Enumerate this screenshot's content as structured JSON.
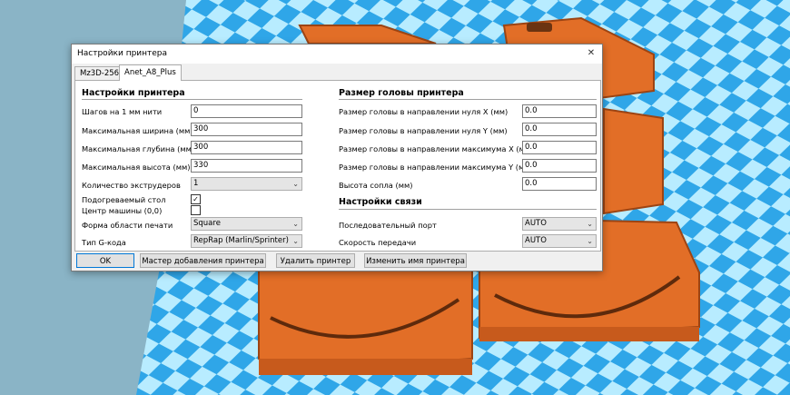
{
  "window": {
    "title": "Настройки принтера",
    "close_glyph": "✕"
  },
  "tabs": [
    {
      "label": "Mz3D-256"
    },
    {
      "label": "Anet_A8_Plus"
    }
  ],
  "left_section": {
    "title": "Настройки принтера",
    "fields": [
      {
        "label": "Шагов на 1 мм нити",
        "value": "0"
      },
      {
        "label": "Максимальная ширина (мм)",
        "value": "300"
      },
      {
        "label": "Максимальная глубина (мм)",
        "value": "300"
      },
      {
        "label": "Максимальная высота (мм)",
        "value": "330"
      }
    ],
    "extruders": {
      "label": "Количество экструдеров",
      "value": "1"
    },
    "heated_bed": {
      "label": "Подогреваемый стол",
      "checked": true,
      "mark": "✓"
    },
    "machine_center": {
      "label": "Центр машины (0,0)",
      "checked": false
    },
    "bed_shape": {
      "label": "Форма области печати",
      "value": "Square"
    },
    "gcode_type": {
      "label": "Тип G-кода",
      "value": "RepRap (Marlin/Sprinter)"
    }
  },
  "right_section": {
    "head_title": "Размер головы принтера",
    "head_fields": [
      {
        "label": "Размер головы в направлении нуля X (мм)",
        "value": "0.0"
      },
      {
        "label": "Размер головы в направлении нуля Y (мм)",
        "value": "0.0"
      },
      {
        "label": "Размер головы в направлении максимума X (мм)",
        "value": "0.0"
      },
      {
        "label": "Размер головы в направлении максимума Y (мм)",
        "value": "0.0"
      },
      {
        "label": "Высота сопла (мм)",
        "value": "0.0"
      }
    ],
    "comm_title": "Настройки связи",
    "serial_port": {
      "label": "Последовательный порт",
      "value": "AUTO"
    },
    "baud_rate": {
      "label": "Скорость передачи",
      "value": "AUTO"
    }
  },
  "buttons": {
    "ok": "OK",
    "wizard": "Мастер добавления принтера",
    "remove": "Удалить принтер",
    "rename": "Изменить имя принтера"
  },
  "icons": {
    "dropdown": "chevron-down-icon",
    "dropdown_glyph": "⌄",
    "close": "close-icon"
  },
  "colors": {
    "background": "#8ab4c6",
    "bed_blue": "#2fa6e8",
    "bed_light": "#b8ecff",
    "part_orange": "#e26e27",
    "accent": "#0078d7"
  }
}
